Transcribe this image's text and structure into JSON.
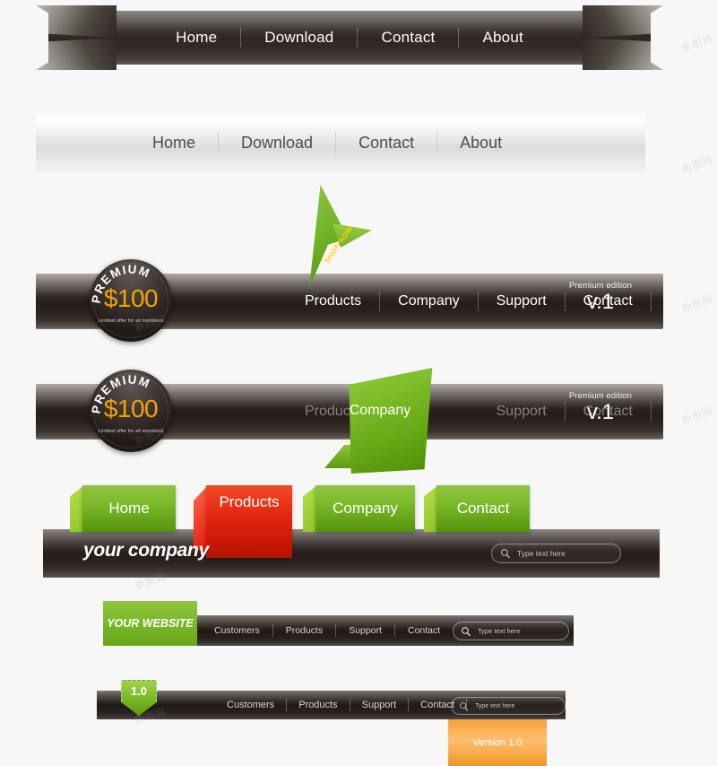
{
  "colors": {
    "green": "#7cba2c",
    "red": "#e2240d",
    "orange": "#f5a300",
    "panel_orange": "#fbb45c",
    "dark": "#241d1a",
    "light_bar": "#e6e6e6"
  },
  "bar1": {
    "name": "dark-ribbon-nav",
    "items": [
      "Home",
      "Download",
      "Contact",
      "About"
    ]
  },
  "bar2": {
    "name": "light-gradient-nav",
    "items": [
      "Home",
      "Download",
      "Contact",
      "About"
    ]
  },
  "bar3": {
    "name": "premium-nav-shop-now",
    "badge": {
      "arc_text": "PREMIUM",
      "price": "$100",
      "note": "Limited offer for all members"
    },
    "flag_label": "SHOP NOW",
    "items": [
      "Products",
      "Company",
      "Support",
      "Contact"
    ],
    "edition": {
      "label": "Premium edition",
      "version": "v.1"
    }
  },
  "bar4": {
    "name": "premium-nav-company-active",
    "badge": {
      "arc_text": "PREMIUM",
      "price": "$100",
      "note": "Limited offer for all members"
    },
    "items": [
      {
        "label": "Products",
        "active": false
      },
      {
        "label": "Company",
        "active": true
      },
      {
        "label": "Support",
        "active": false
      },
      {
        "label": "Contact",
        "active": false
      }
    ],
    "edition": {
      "label": "Premium edition",
      "version": "v.1"
    }
  },
  "bar5": {
    "name": "tabbed-nav-your-company",
    "tabs": [
      {
        "label": "Home",
        "color": "green"
      },
      {
        "label": "Products",
        "color": "red"
      },
      {
        "label": "Company",
        "color": "green"
      },
      {
        "label": "Contact",
        "color": "green"
      }
    ],
    "brand": "your company",
    "search_placeholder": "Type text here"
  },
  "bar6": {
    "name": "your-website-nav",
    "brand": "YOUR WEBSITE",
    "items": [
      "Customers",
      "Products",
      "Support",
      "Contact"
    ],
    "search_placeholder": "Type text here"
  },
  "bar7": {
    "name": "version-nav",
    "badge": "1.0",
    "items": [
      "Customers",
      "Products",
      "Support",
      "Contact"
    ],
    "search_placeholder": "Type text here",
    "version_panel": "Version 1.0"
  },
  "watermarks": [
    "新图网",
    "新图网",
    "新图网",
    "新图网",
    "新图网",
    "新图网",
    "新图网",
    "新图网"
  ]
}
